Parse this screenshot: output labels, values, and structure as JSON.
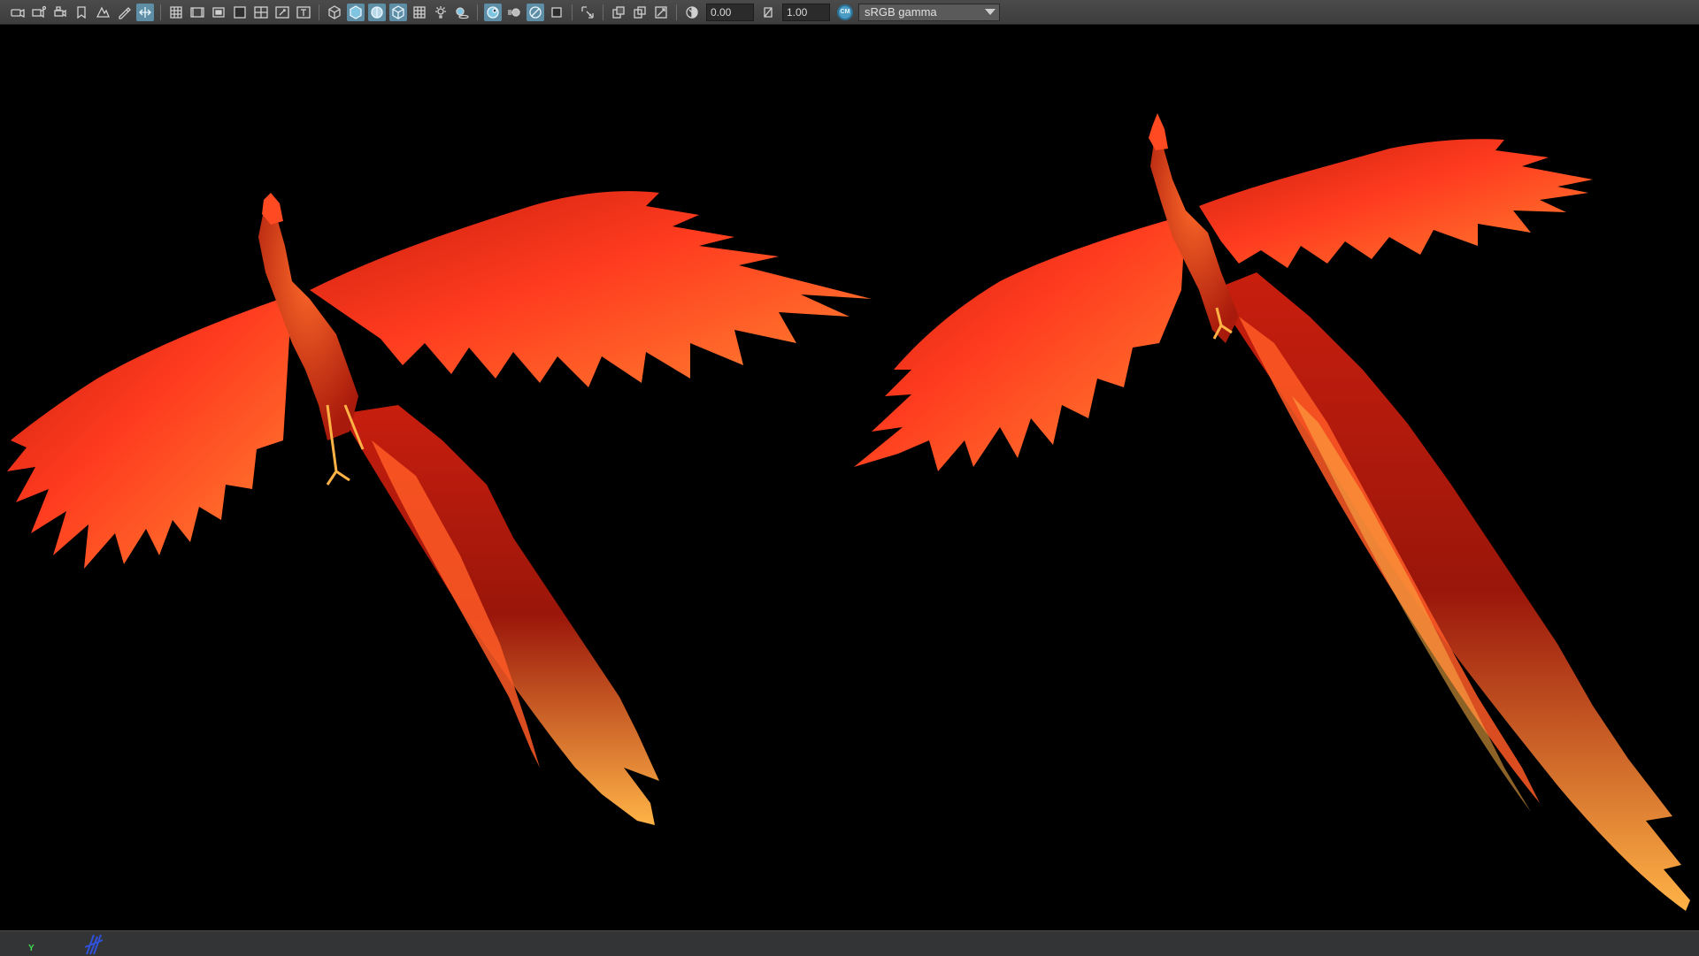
{
  "toolbar": {
    "exposure_value": "0.00",
    "gamma_value": "1.00",
    "view_transform": "sRGB gamma",
    "icons_group1": [
      "camera-icon",
      "camera-attributes-icon",
      "bookmark-camera-icon",
      "bookmark-icon",
      "image-plane-icon",
      "grease-pencil-icon",
      "2d-pan-zoom-icon"
    ],
    "icons_group2": [
      "grid-icon",
      "film-gate-icon",
      "resolution-gate-icon",
      "gate-mask-icon",
      "field-chart-icon",
      "safe-action-icon",
      "safe-title-icon"
    ],
    "icons_group3": [
      "wireframe-icon",
      "smooth-shade-icon",
      "default-material-icon",
      "wireframe-on-shaded-icon",
      "textured-icon",
      "use-all-lights-icon",
      "shadows-icon"
    ],
    "icons_group4": [
      "screen-space-ao-icon",
      "motion-blur-icon",
      "anti-aliasing-icon",
      "depth-of-field-icon"
    ],
    "icons_group5": [
      "isolate-select-icon"
    ],
    "icons_group6": [
      "xray-icon",
      "xray-active-icon",
      "xray-joints-icon"
    ],
    "icons_group7": [
      "exposure-icon"
    ],
    "icons_group8": [
      "gamma-icon"
    ],
    "colormgmt_icon": "color-management-icon",
    "colormgmt_text": "CM",
    "active_icons": [
      "2d-pan-zoom-icon",
      "smooth-shade-icon",
      "default-material-icon",
      "wireframe-on-shaded-icon",
      "screen-space-ao-icon",
      "anti-aliasing-icon"
    ]
  },
  "viewport": {
    "background": "#000000",
    "feather_colors": [
      "#ff3b1f",
      "#ff6a2a",
      "#ffb347",
      "#c81e0e",
      "#ffd27a"
    ]
  },
  "bottom": {
    "axis_label": "Y",
    "axis_color": "#3fdb4f"
  }
}
